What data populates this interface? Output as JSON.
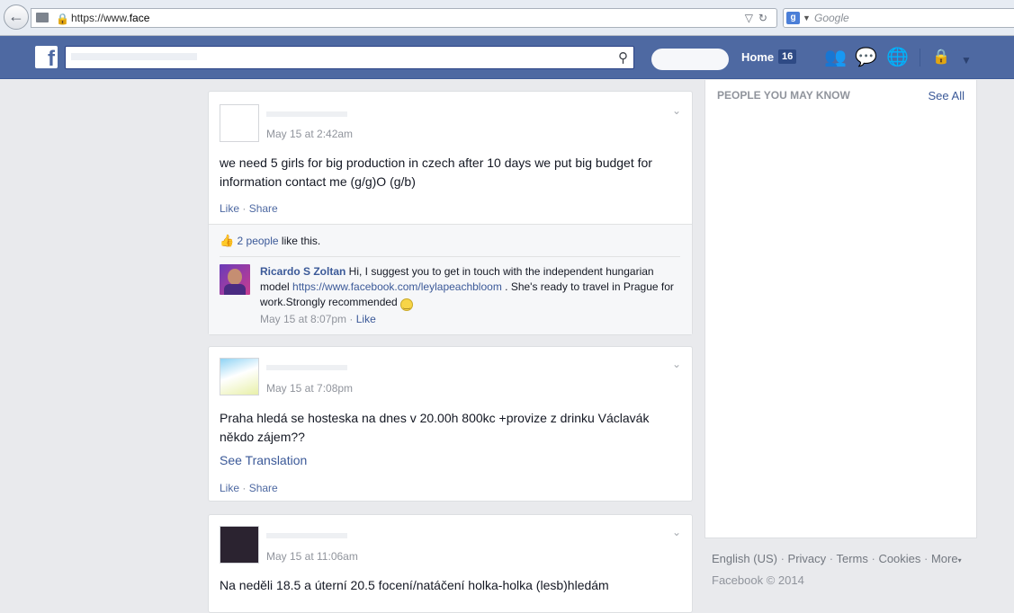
{
  "browser": {
    "url_prefix": "https://www.",
    "url_domain": "face",
    "search_placeholder": "Google",
    "search_engine_letter": "g"
  },
  "fbbar": {
    "logo_letter": "f",
    "home_label": "Home",
    "home_count": "16",
    "brand_color": "#4e69a2"
  },
  "posts": [
    {
      "timestamp": "May 15 at 2:42am",
      "text": "we need 5 girls for big production in czech after 10 days we put big budget for information contact me (g/g)O (g/b)",
      "like_label": "Like",
      "share_label": "Share",
      "likes_count_text": "2 people",
      "likes_suffix": " like this.",
      "comment": {
        "author": "Ricardo S Zoltan",
        "text_before": " Hi, I suggest you to get in touch with the independent hungarian model ",
        "link": "https://www.facebook.com/leylapeachbloom",
        "text_after": " . She's ready to travel in Prague for work.Strongly recommended ",
        "timestamp": "May 15 at 8:07pm",
        "like_label": "Like"
      }
    },
    {
      "timestamp": "May 15 at 7:08pm",
      "text": "Praha hledá se hosteska na dnes v 20.00h 800kc +provize z drinku Václavák někdo zájem??",
      "see_translation": "See Translation",
      "like_label": "Like",
      "share_label": "Share"
    },
    {
      "timestamp": "May 15 at 11:06am",
      "text": "Na neděli 18.5 a úterní 20.5 focení/natáčení holka-holka (lesb)hledám"
    }
  ],
  "sidebar": {
    "pymk_title": "PEOPLE YOU MAY KNOW",
    "see_all": "See All"
  },
  "footer": {
    "links": [
      "English (US)",
      "Privacy",
      "Terms",
      "Cookies",
      "More"
    ],
    "copyright": "Facebook © 2014"
  }
}
